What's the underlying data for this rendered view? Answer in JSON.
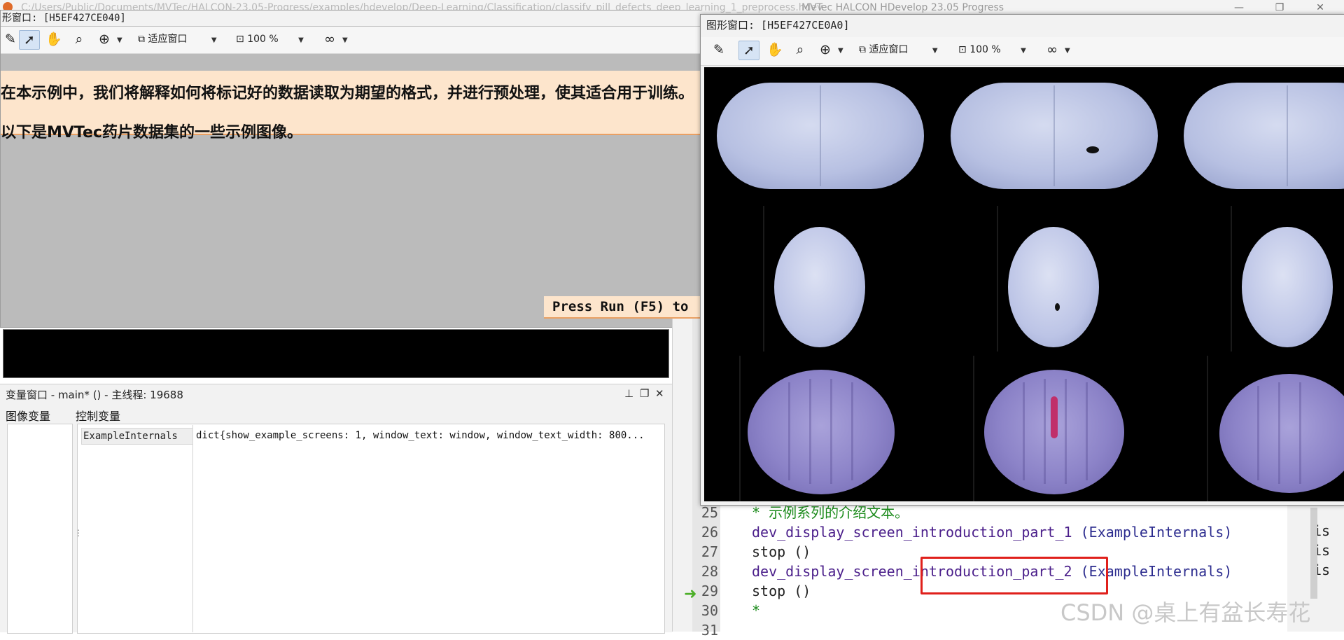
{
  "os_titlebar": {
    "path_text": "C:/Users/Public/Documents/MVTec/HALCON-23.05-Progress/examples/hdevelop/Deep-Learning/Classification/classify_pill_defects_deep_learning_1_preprocess.hdev",
    "app_title": "MVTec HALCON HDevelop 23.05 Progress",
    "minimize_glyph": "—",
    "maximize_glyph": "❐",
    "close_glyph": "✕"
  },
  "graphics_window_left": {
    "title": "形窗口: [H5EF427CE040]",
    "toolbar": {
      "fit_window_label": "适应窗口",
      "zoom_value": "100 %"
    },
    "banner_line_1": "在本示例中，我们将解释如何将标记好的数据读取为期望的格式，并进行预处理，使其适合用于训练。",
    "banner_line_2": "以下是MVTec药片数据集的一些示例图像。",
    "press_run_text": "Press Run (F5) to"
  },
  "variable_window": {
    "title": "变量窗口 - main* () - 主线程: 19688",
    "tab_image_vars": "图像变量",
    "tab_control_vars": "控制变量",
    "rows": [
      {
        "name": "ExampleInternals",
        "value": "dict{show_example_screens: 1, window_text: window, window_text_width: 800..."
      }
    ]
  },
  "graphics_window_right": {
    "title": "图形窗口: [H5EF427CE0A0]",
    "toolbar": {
      "fit_window_label": "适应窗口",
      "zoom_value": "100 %"
    }
  },
  "editor": {
    "lines": [
      {
        "num": "25",
        "text": "* 示例系列的介绍文本。",
        "kind": "comment"
      },
      {
        "num": "26",
        "proc": "dev_display_screen_introduction_part_1",
        "args": "(ExampleInternals)",
        "kind": "call"
      },
      {
        "num": "27",
        "text": "stop ()",
        "kind": "op"
      },
      {
        "num": "28",
        "proc": "dev_display_screen_introduction_part_2",
        "args": "(ExampleInternals)",
        "kind": "call"
      },
      {
        "num": "29",
        "text": "stop ()",
        "kind": "op"
      },
      {
        "num": "30",
        "text": "*",
        "kind": "comment"
      },
      {
        "num": "31",
        "text": "",
        "kind": "op"
      }
    ],
    "right_fragment": "is"
  },
  "watermark": "CSDN @桌上有盆长寿花"
}
